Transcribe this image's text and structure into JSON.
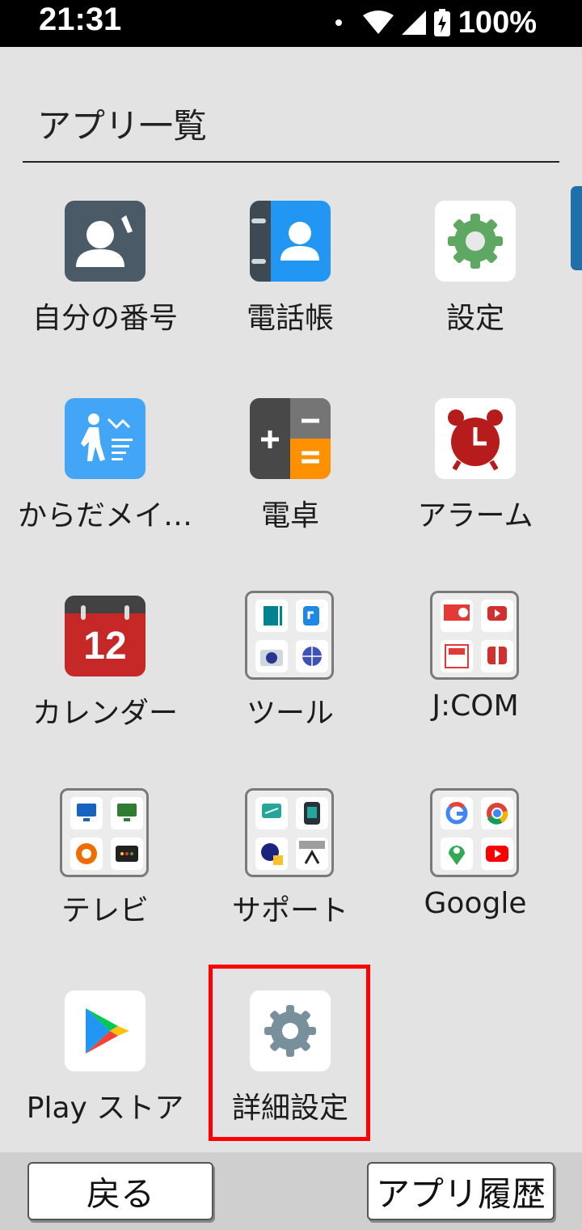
{
  "status": {
    "time": "21:31",
    "battery": "100%"
  },
  "title": "アプリ一覧",
  "apps": [
    {
      "label": "自分の番号",
      "icon": "my-number-icon"
    },
    {
      "label": "電話帳",
      "icon": "contacts-icon"
    },
    {
      "label": "設定",
      "icon": "settings-gear-icon"
    },
    {
      "label": "からだメイ…",
      "icon": "body-meister-icon"
    },
    {
      "label": "電卓",
      "icon": "calculator-icon"
    },
    {
      "label": "アラーム",
      "icon": "alarm-clock-icon"
    },
    {
      "label": "カレンダー",
      "icon": "calendar-icon",
      "date": "12"
    },
    {
      "label": "ツール",
      "icon": "tools-folder-icon"
    },
    {
      "label": "J:COM",
      "icon": "jcom-folder-icon"
    },
    {
      "label": "テレビ",
      "icon": "tv-folder-icon"
    },
    {
      "label": "サポート",
      "icon": "support-folder-icon"
    },
    {
      "label": "Google",
      "icon": "google-folder-icon"
    },
    {
      "label": "Play ストア",
      "icon": "play-store-icon"
    },
    {
      "label": "詳細設定",
      "icon": "advanced-settings-icon"
    }
  ],
  "bottom": {
    "back": "戻る",
    "history": "アプリ履歴"
  },
  "colors": {
    "highlight": "#ff0000",
    "scrollbar": "#1f6fa8"
  }
}
